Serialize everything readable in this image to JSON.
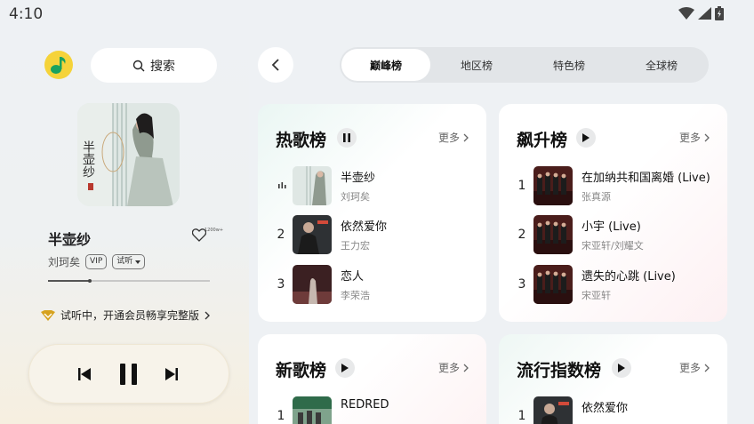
{
  "status": {
    "time": "4:10"
  },
  "search": {
    "label": "搜索"
  },
  "now_playing": {
    "title": "半壶纱",
    "artist": "刘珂矣",
    "tags": [
      "VIP",
      "试听"
    ],
    "like_count": "1200w+",
    "progress": 0.26,
    "cover_text": "半壶纱",
    "vip_hint": "试听中，开通会员畅享完整版"
  },
  "tabs": [
    {
      "label": "巅峰榜",
      "active": true
    },
    {
      "label": "地区榜",
      "active": false
    },
    {
      "label": "特色榜",
      "active": false
    },
    {
      "label": "全球榜",
      "active": false
    }
  ],
  "cards": [
    {
      "title": "热歌榜",
      "more": "更多",
      "songs": [
        {
          "rank": "",
          "title": "半壶纱",
          "artist": "刘珂矣"
        },
        {
          "rank": "2",
          "title": "依然爱你",
          "artist": "王力宏"
        },
        {
          "rank": "3",
          "title": "恋人",
          "artist": "李荣浩"
        }
      ]
    },
    {
      "title": "飙升榜",
      "more": "更多",
      "songs": [
        {
          "rank": "1",
          "title": "在加纳共和国离婚 (Live)",
          "artist": "张真源"
        },
        {
          "rank": "2",
          "title": "小宇 (Live)",
          "artist": "宋亚轩/刘耀文"
        },
        {
          "rank": "3",
          "title": "遗失的心跳 (Live)",
          "artist": "宋亚轩"
        }
      ]
    },
    {
      "title": "新歌榜",
      "more": "更多",
      "songs": [
        {
          "rank": "1",
          "title": "REDRED",
          "artist": ""
        }
      ]
    },
    {
      "title": "流行指数榜",
      "more": "更多",
      "songs": [
        {
          "rank": "1",
          "title": "依然爱你",
          "artist": ""
        }
      ]
    }
  ]
}
